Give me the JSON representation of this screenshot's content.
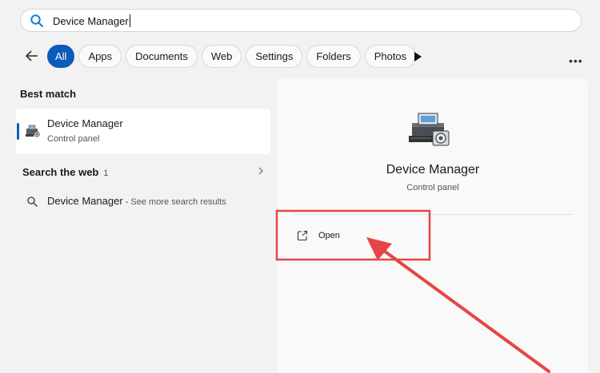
{
  "search": {
    "query": "Device Manager"
  },
  "filters": [
    {
      "label": "All",
      "active": true
    },
    {
      "label": "Apps"
    },
    {
      "label": "Documents"
    },
    {
      "label": "Web"
    },
    {
      "label": "Settings"
    },
    {
      "label": "Folders"
    },
    {
      "label": "Photos"
    }
  ],
  "more_label": "•••",
  "best_match": {
    "heading": "Best match",
    "name": "Device Manager",
    "type": "Control panel"
  },
  "web_section": {
    "heading": "Search the web",
    "count": "1",
    "result_name": "Device Manager",
    "result_hint": " - See more search results"
  },
  "detail": {
    "title": "Device Manager",
    "subtitle": "Control panel",
    "action_label": "Open"
  },
  "icons": {
    "search": "search-icon",
    "back": "back-arrow-icon",
    "play": "play-icon",
    "more": "more-icon",
    "open": "external-link-icon",
    "device_manager": "device-manager-icon"
  },
  "colors": {
    "accent": "#0b5cba",
    "annotation": "#e64545",
    "background": "#f2f2f2"
  }
}
